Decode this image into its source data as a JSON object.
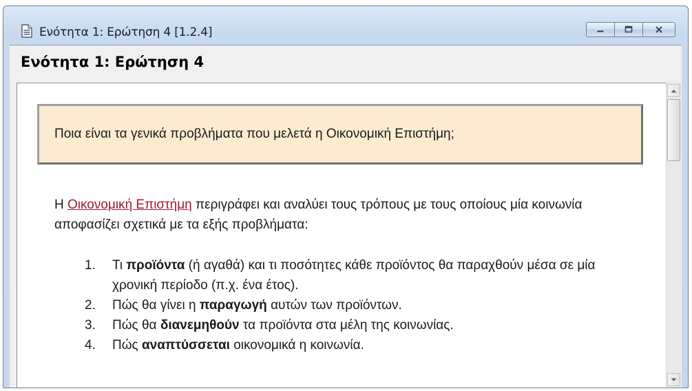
{
  "window": {
    "title": "Ενότητα 1: Ερώτηση 4   [1.2.4]",
    "icon": "document-icon",
    "controls": [
      "minimize-icon",
      "maximize-icon",
      "close-icon"
    ]
  },
  "page": {
    "heading": "Ενότητα 1: Ερώτηση 4",
    "question": "Ποια είναι τα γενικά προβλήματα που μελετά η Οικονομική Επιστήμη;",
    "answer_link": "Οικονομική Επιστήμη",
    "answer_prefix": "Η ",
    "answer_rest": " περιγράφει και αναλύει τους τρόπους με τους οποίους μία κοινωνία αποφασίζει σχετικά με τα εξής προβλήματα:",
    "items": [
      {
        "num": "1.",
        "pre": "Τι ",
        "bold": "προϊόντα",
        "post": " (ή αγαθά) και τι ποσότητες κάθε προϊόντος θα παραχθούν μέσα σε μία χρονική περίοδο (π.χ. ένα έτος)."
      },
      {
        "num": "2.",
        "pre": "Πώς θα γίνει η ",
        "bold": "παραγωγή",
        "post": " αυτών των προϊόντων."
      },
      {
        "num": "3.",
        "pre": "Πώς θα ",
        "bold": "διανεμηθούν",
        "post": " τα προϊόντα στα μέλη της κοινωνίας."
      },
      {
        "num": "4.",
        "pre": "Πώς ",
        "bold": "αναπτύσσεται",
        "post": " οικονομικά η κοινωνία."
      }
    ]
  },
  "colors": {
    "question_bg": "#fdebd1",
    "link": "#9b1c2e"
  }
}
